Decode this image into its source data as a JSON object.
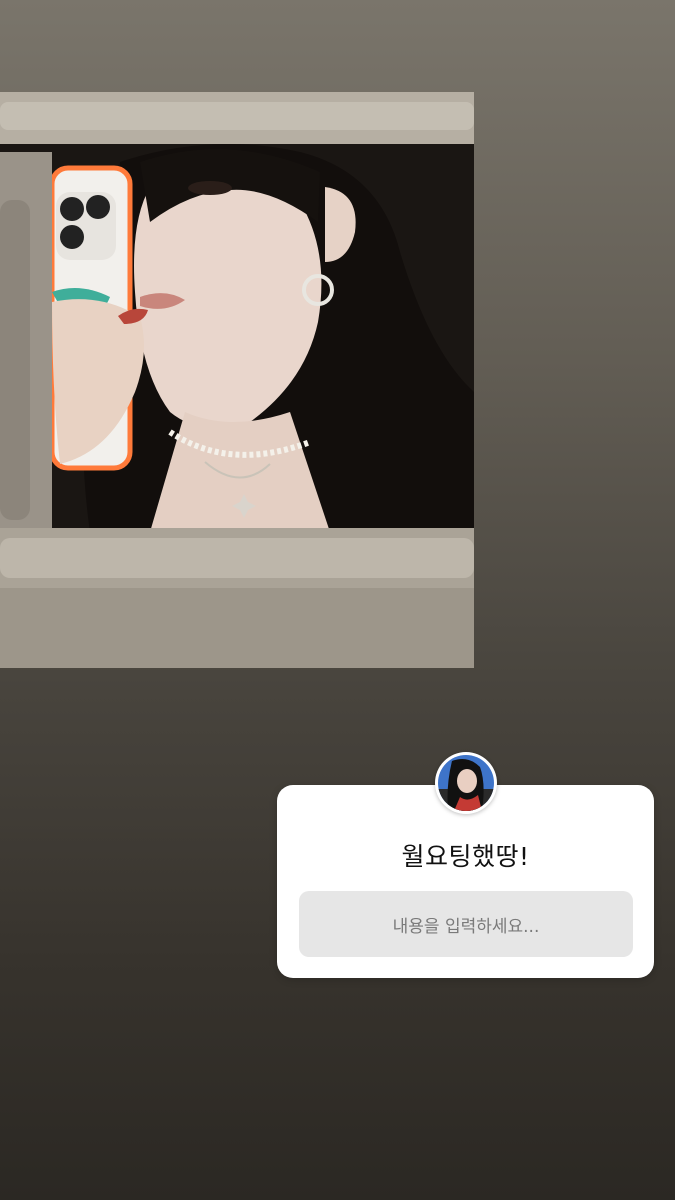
{
  "story": {
    "photo": {
      "subject": "mirror selfie with phone",
      "icon": "photo"
    },
    "question_sticker": {
      "avatar_icon": "profile-avatar",
      "question_text": "월요팅했땅!",
      "answer_placeholder": "내용을 입력하세요..."
    }
  },
  "colors": {
    "background_top": "#7a756b",
    "background_bottom": "#2b2823",
    "sticker_bg": "#ffffff",
    "field_bg": "#e6e6e6"
  }
}
